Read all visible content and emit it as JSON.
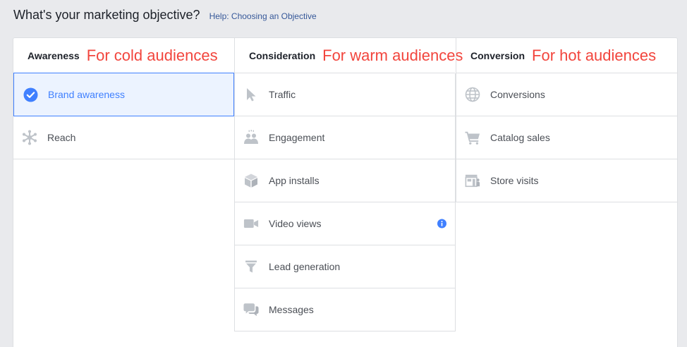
{
  "header": {
    "title": "What's your marketing objective?",
    "help_link": "Help: Choosing an Objective"
  },
  "columns": [
    {
      "label": "Awareness",
      "annotation": "For cold audiences",
      "items": [
        {
          "label": "Brand awareness",
          "icon": "checkmark-circle-icon",
          "selected": true
        },
        {
          "label": "Reach",
          "icon": "reach-icon",
          "selected": false
        }
      ]
    },
    {
      "label": "Consideration",
      "annotation": "For warm audiences",
      "items": [
        {
          "label": "Traffic",
          "icon": "cursor-icon"
        },
        {
          "label": "Engagement",
          "icon": "people-icon"
        },
        {
          "label": "App installs",
          "icon": "box-icon"
        },
        {
          "label": "Video views",
          "icon": "video-camera-icon",
          "info": true
        },
        {
          "label": "Lead generation",
          "icon": "funnel-icon"
        },
        {
          "label": "Messages",
          "icon": "chat-bubbles-icon"
        }
      ]
    },
    {
      "label": "Conversion",
      "annotation": "For hot audiences",
      "items": [
        {
          "label": "Conversions",
          "icon": "globe-icon"
        },
        {
          "label": "Catalog sales",
          "icon": "shopping-cart-icon"
        },
        {
          "label": "Store visits",
          "icon": "store-icon"
        }
      ]
    }
  ],
  "colors": {
    "accent": "#4080ff",
    "annotation": "#f2453d",
    "icon_gray": "#bec3c9",
    "border": "#dddfe2",
    "help_link": "#365899"
  }
}
